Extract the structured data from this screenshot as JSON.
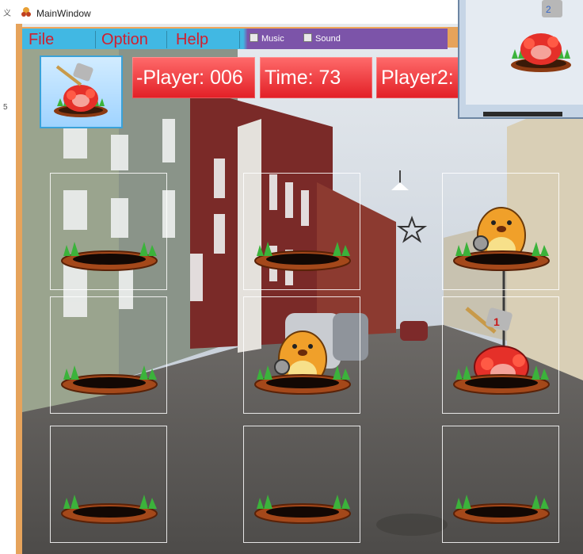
{
  "window": {
    "title": "MainWindow"
  },
  "menu": {
    "items": [
      {
        "label": "File"
      },
      {
        "label": "Option"
      },
      {
        "label": "Help"
      }
    ],
    "checkboxes": [
      {
        "label": "Music",
        "checked": false
      },
      {
        "label": "Sound",
        "checked": false
      }
    ]
  },
  "scoreboard": {
    "player1": "-Player: 006",
    "time": "Time: 73",
    "player2": "Player2:"
  },
  "board": {
    "cells": [
      {
        "state": "empty"
      },
      {
        "state": "empty"
      },
      {
        "state": "mole"
      },
      {
        "state": "empty"
      },
      {
        "state": "mole"
      },
      {
        "state": "hit-mole",
        "hit_number": "1"
      },
      {
        "state": "empty"
      },
      {
        "state": "empty"
      },
      {
        "state": "empty"
      }
    ]
  },
  "popup": {
    "hit_number": "2"
  },
  "left_edge_marks": [
    "义",
    "5"
  ],
  "colors": {
    "menu_left": "#41b8e3",
    "menu_right": "#7c54a9",
    "menu_text": "#d11f2e",
    "score_red": "#e21f26",
    "frame_orange": "#e6a35b"
  }
}
